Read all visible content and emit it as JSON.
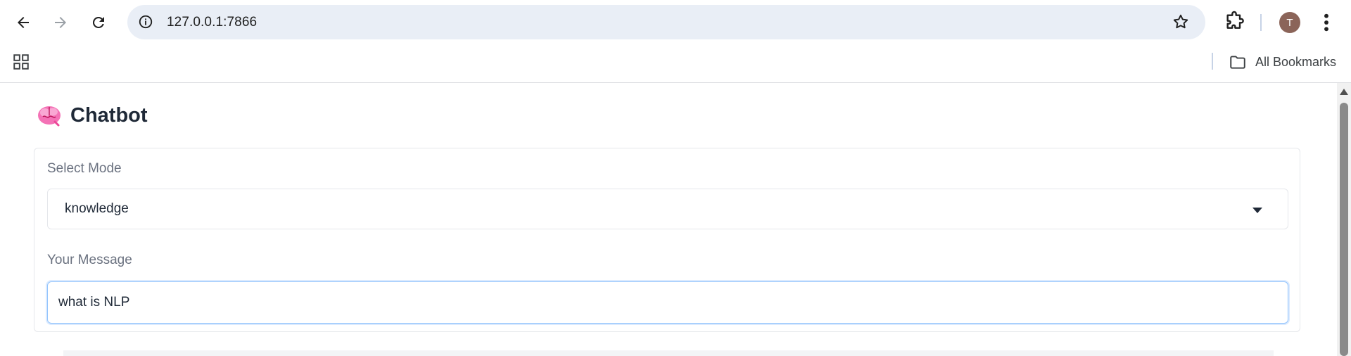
{
  "browser": {
    "url": "127.0.0.1:7866",
    "profile_initial": "T",
    "bookmarks_label": "All Bookmarks",
    "icons": [
      "back-arrow-icon",
      "forward-arrow-icon",
      "reload-icon",
      "site-info-icon",
      "bookmark-star-icon",
      "extensions-icon",
      "kebab-menu-icon",
      "apps-grid-icon",
      "folder-icon"
    ]
  },
  "app": {
    "title": "Chatbot",
    "title_icon": "brain-icon",
    "mode": {
      "label": "Select Mode",
      "selected": "knowledge"
    },
    "message": {
      "label": "Your Message",
      "value": "what is NLP"
    },
    "colors": {
      "input_focus_border": "#93c5fd",
      "avatar": "#8b6459",
      "omnibox_bg": "#e9eef6"
    }
  }
}
